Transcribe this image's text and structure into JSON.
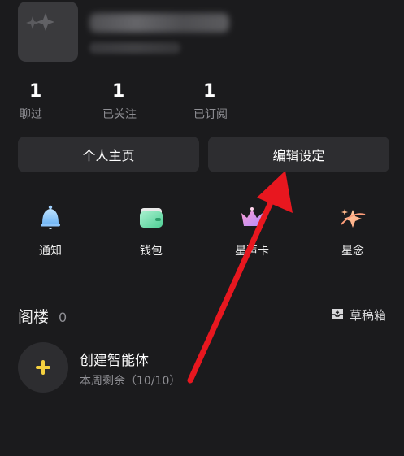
{
  "stats": [
    {
      "value": "1",
      "label": "聊过"
    },
    {
      "value": "1",
      "label": "已关注"
    },
    {
      "value": "1",
      "label": "已订阅"
    }
  ],
  "buttons": {
    "homepage": "个人主页",
    "edit_settings": "编辑设定"
  },
  "quick_actions": [
    {
      "label": "通知",
      "icon": "bell-icon"
    },
    {
      "label": "钱包",
      "icon": "wallet-icon"
    },
    {
      "label": "星声卡",
      "icon": "crown-card-icon"
    },
    {
      "label": "星念",
      "icon": "sparkle-star-icon"
    }
  ],
  "section": {
    "title": "阁楼",
    "count": "0",
    "drafts_label": "草稿箱"
  },
  "create_agent": {
    "title": "创建智能体",
    "subtitle": "本周剩余（10/10）"
  },
  "colors": {
    "background": "#1b1b1d",
    "card": "#2d2d30",
    "accent_yellow": "#f4d03f",
    "arrow_red": "#e8171f"
  }
}
